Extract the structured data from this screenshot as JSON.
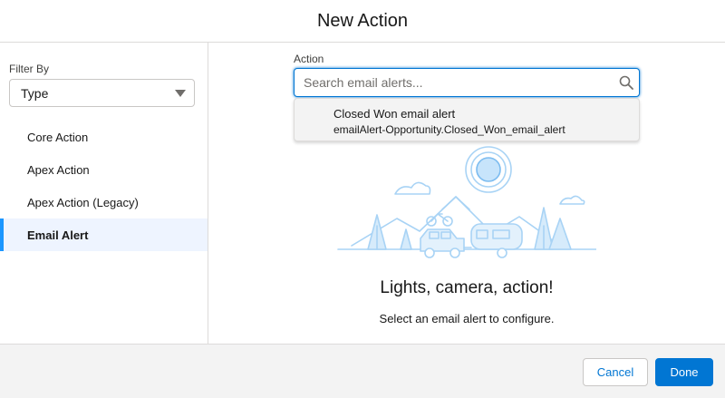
{
  "modal": {
    "title": "New Action"
  },
  "sidebar": {
    "filter_label": "Filter By",
    "filter_value": "Type",
    "items": [
      {
        "label": "Core Action",
        "active": false
      },
      {
        "label": "Apex Action",
        "active": false
      },
      {
        "label": "Apex Action (Legacy)",
        "active": false
      },
      {
        "label": "Email Alert",
        "active": true
      }
    ]
  },
  "main": {
    "field_label": "Action",
    "search_placeholder": "Search email alerts...",
    "search_value": "",
    "dropdown": {
      "title": "Closed Won email alert",
      "subtitle": "emailAlert-Opportunity.Closed_Won_email_alert"
    },
    "empty_title": "Lights, camera, action!",
    "empty_subtitle": "Select an email alert to configure."
  },
  "footer": {
    "cancel_label": "Cancel",
    "done_label": "Done"
  },
  "colors": {
    "brand": "#0176d3",
    "active_bg": "#eef4ff",
    "illustration": "#a8d3f5"
  }
}
